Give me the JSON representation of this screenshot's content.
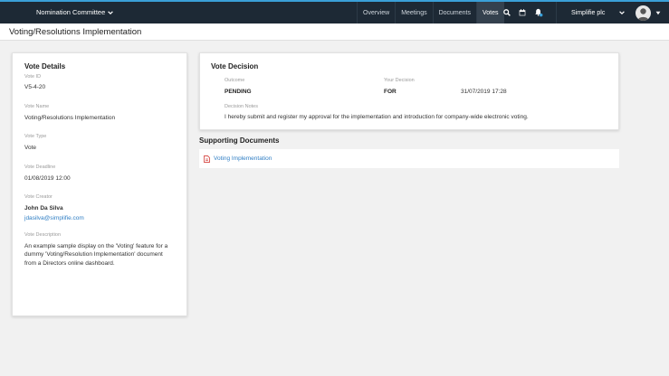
{
  "header": {
    "committee": "Nomination Committee",
    "nav": [
      "Overview",
      "Meetings",
      "Documents",
      "Votes"
    ],
    "company": "Simplifie plc"
  },
  "page": {
    "title": "Voting/Resolutions Implementation"
  },
  "details": {
    "title": "Vote Details",
    "vote_id_label": "Vote ID",
    "vote_id": "V5-4-20",
    "vote_name_label": "Vote Name",
    "vote_name": "Voting/Resolutions Implementation",
    "vote_type_label": "Vote Type",
    "vote_type": "Vote",
    "deadline_label": "Vote Deadline",
    "deadline": "01/08/2019 12:00",
    "creator_label": "Vote Creator",
    "creator_name": "John Da Silva",
    "creator_email": "jdasilva@simplifie.com",
    "description_label": "Vote Description",
    "description": "An example sample display on the 'Voting' feature for a dummy 'Voting/Resolution Implementation' document from a Directors online dashboard."
  },
  "decision": {
    "title": "Vote Decision",
    "outcome_label": "Outcome",
    "outcome": "PENDING",
    "your_decision_label": "Your Decision",
    "your_decision": "FOR",
    "decision_time": "31/07/2019 17:28",
    "notes_label": "Decision Notes",
    "notes": "I hereby submit and register my approval for the implementation and introduction for company-wide electronic voting."
  },
  "supporting": {
    "title": "Supporting Documents",
    "documents": [
      "Voting Implementation"
    ]
  },
  "colors": {
    "topbar": "#1d2935",
    "accent": "#3aa0d8",
    "link": "#2f7ec4",
    "pdf": "#d9534f"
  }
}
